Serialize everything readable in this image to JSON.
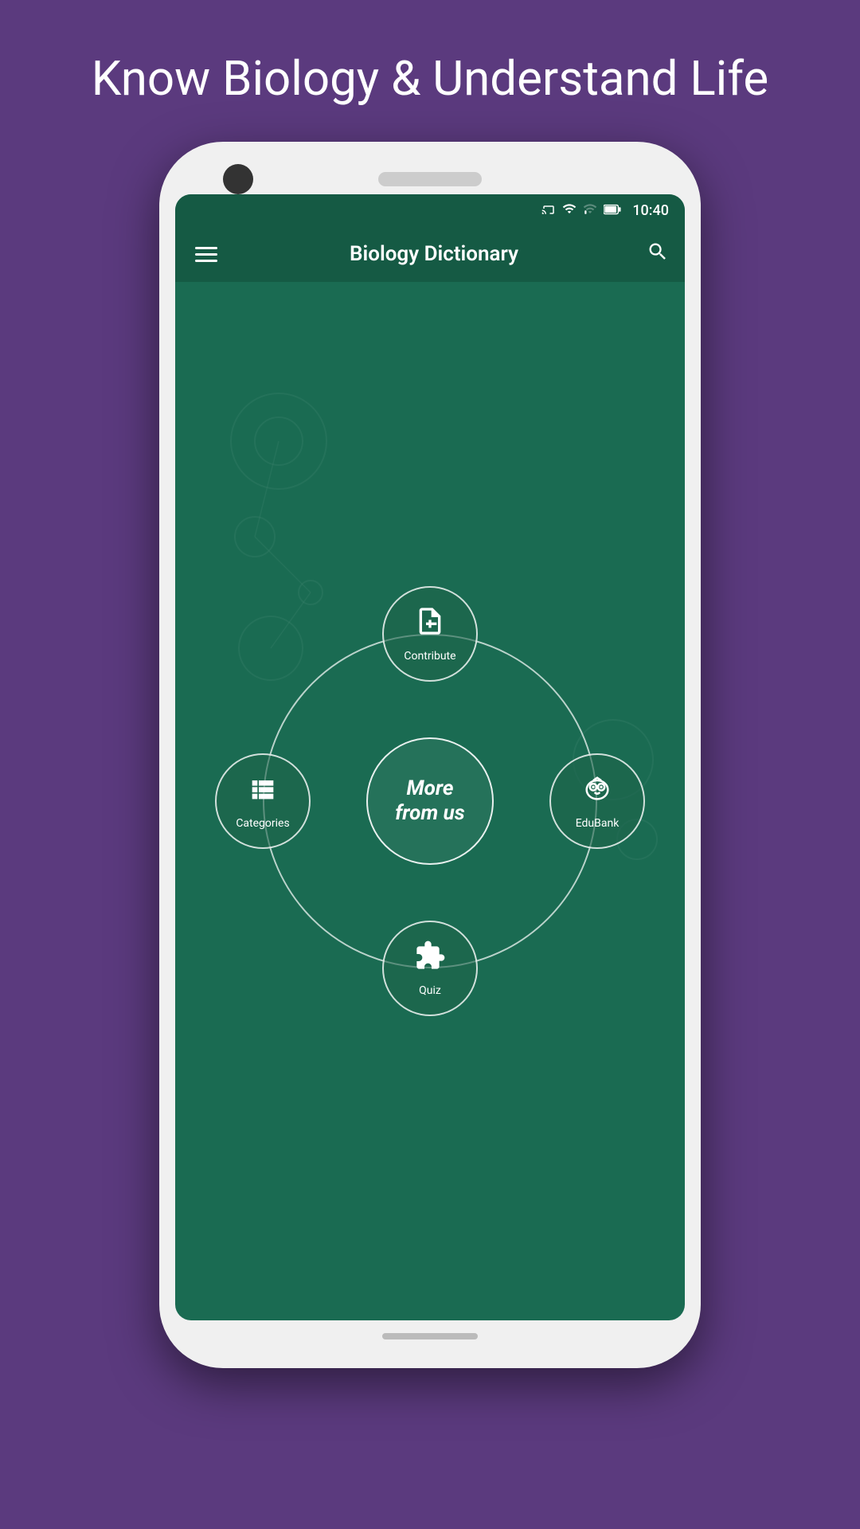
{
  "page": {
    "background_color": "#5b3a7e",
    "header_text": "Know Biology & Understand Life"
  },
  "status_bar": {
    "time": "10:40",
    "icons": [
      "cast",
      "wifi",
      "signal",
      "battery"
    ]
  },
  "toolbar": {
    "title": "Biology Dictionary",
    "menu_label": "menu",
    "search_label": "search"
  },
  "center_button": {
    "line1": "More",
    "line2": "from us",
    "full_text": "More from us"
  },
  "satellites": [
    {
      "id": "contribute",
      "label": "Contribute",
      "position": "top",
      "icon": "contribute-icon"
    },
    {
      "id": "categories",
      "label": "Categories",
      "position": "left",
      "icon": "categories-icon"
    },
    {
      "id": "edubank",
      "label": "EduBank",
      "position": "right",
      "icon": "edubank-icon"
    },
    {
      "id": "quiz",
      "label": "Quiz",
      "position": "bottom",
      "icon": "quiz-icon"
    }
  ]
}
